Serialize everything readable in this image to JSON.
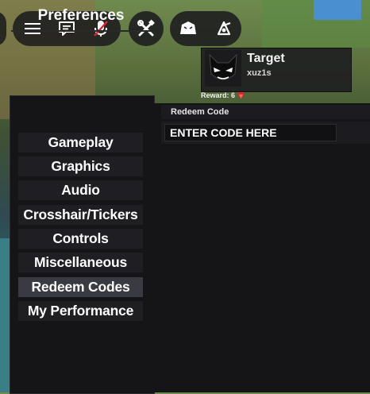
{
  "top_bar": {
    "icons": [
      "menu-icon",
      "chat-icon",
      "mic-muted-icon",
      "tools-icon",
      "emote-icon",
      "emote-alt-icon"
    ]
  },
  "target": {
    "title": "Target",
    "username": "xuz1s",
    "reward_label": "Reward: 6"
  },
  "sidebar": {
    "title": "Preferences",
    "items": [
      {
        "label": "Gameplay"
      },
      {
        "label": "Graphics"
      },
      {
        "label": "Audio"
      },
      {
        "label": "Crosshair/Tickers"
      },
      {
        "label": "Controls"
      },
      {
        "label": "Miscellaneous"
      },
      {
        "label": "Redeem Codes"
      },
      {
        "label": "My Performance"
      }
    ],
    "active_item": "Redeem Codes"
  },
  "redeem": {
    "header": "Redeem Code",
    "input_placeholder": "ENTER CODE HERE",
    "input_value": ""
  },
  "colors": {
    "panel_bg": "#151518",
    "item_bg": "#1f1f23",
    "item_active_bg": "#3a3a42",
    "text": "#ffffff",
    "gem": "#e0242c"
  }
}
